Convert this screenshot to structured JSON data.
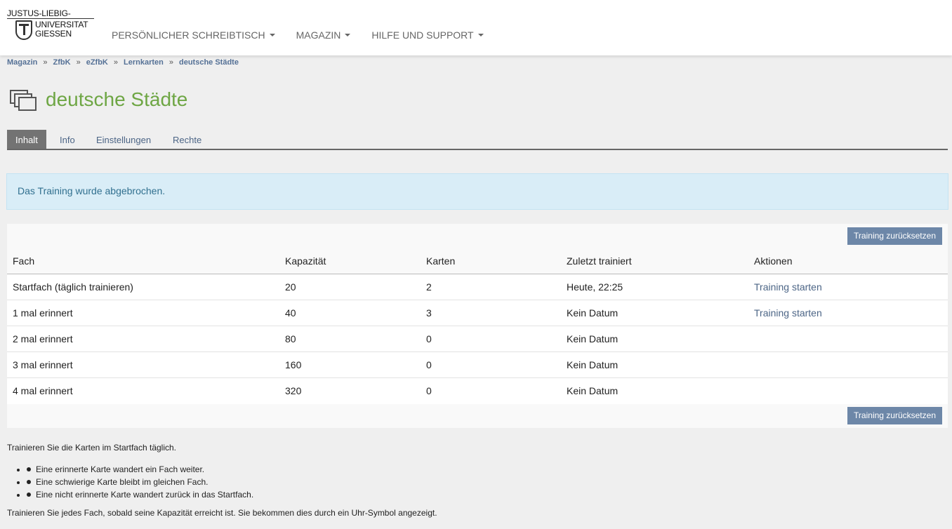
{
  "logo": {
    "line1": "JUSTUS-LIEBIG-",
    "line2": "UNIVERSITAT",
    "line3": "GIESSEN"
  },
  "nav": [
    {
      "label": "PERSÖNLICHER SCHREIBTISCH"
    },
    {
      "label": "MAGAZIN"
    },
    {
      "label": "HILFE UND SUPPORT"
    }
  ],
  "breadcrumb": [
    "Magazin",
    "ZfbK",
    "eZfbK",
    "Lernkarten",
    "deutsche Städte"
  ],
  "breadcrumb_sep": "»",
  "title": "deutsche Städte",
  "tabs": [
    "Inhalt",
    "Info",
    "Einstellungen",
    "Rechte"
  ],
  "message": "Das Training wurde abgebrochen.",
  "reset_button": "Training zurücksetzen",
  "table": {
    "headers": [
      "Fach",
      "Kapazität",
      "Karten",
      "Zuletzt trainiert",
      "Aktionen"
    ],
    "rows": [
      [
        "Startfach (täglich trainieren)",
        "20",
        "2",
        "Heute, 22:25",
        "Training starten"
      ],
      [
        "1 mal erinnert",
        "40",
        "3",
        "Kein Datum",
        "Training starten"
      ],
      [
        "2 mal erinnert",
        "80",
        "0",
        "Kein Datum",
        ""
      ],
      [
        "3 mal erinnert",
        "160",
        "0",
        "Kein Datum",
        ""
      ],
      [
        "4 mal erinnert",
        "320",
        "0",
        "Kein Datum",
        ""
      ]
    ]
  },
  "help": {
    "intro": "Trainieren Sie die Karten im Startfach täglich.",
    "bullets": [
      "Eine erinnerte Karte wandert ein Fach weiter.",
      "Eine schwierige Karte bleibt im gleichen Fach.",
      "Eine nicht erinnerte Karte wandert zurück in das Startfach."
    ],
    "outro": "Trainieren Sie jedes Fach, sobald seine Kapazität erreicht ist. Sie bekommen dies durch ein Uhr-Symbol angezeigt."
  },
  "colors": {
    "title_green": "#6ea644",
    "link_blue": "#4c6586",
    "button_bg": "#6d87a8",
    "info_bg": "#d9edf7"
  }
}
